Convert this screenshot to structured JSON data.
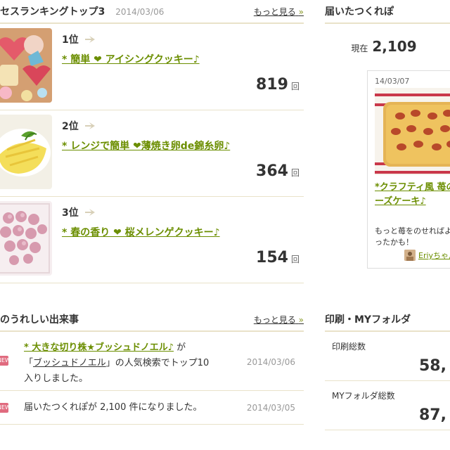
{
  "access_ranking": {
    "title": "セスランキングトップ3",
    "date": "2014/03/06",
    "more_link": "もっと見る",
    "more_arrow": "»",
    "unit": "回",
    "items": [
      {
        "rank": "1位",
        "title": "* 簡単 ❤ アイシングクッキー♪",
        "count": "819"
      },
      {
        "rank": "2位",
        "title": "* レンジで簡単 ❤薄焼き卵de錦糸卵♪",
        "count": "364"
      },
      {
        "rank": "3位",
        "title": "* 春の香り ❤ 桜メレンゲクッキー♪",
        "count": "154"
      }
    ]
  },
  "tsukurepo": {
    "title": "届いたつくれぽ",
    "current_label": "現在",
    "current_value": "2,109",
    "card": {
      "date": "14/03/07",
      "title": "*クラフティ風 苺のチーズケーキ♪",
      "comment": "もっと苺をのせればよかったかも！",
      "user": "Eriyちゃん"
    }
  },
  "events": {
    "title": "のうれしい出来事",
    "more_link": "もっと見る",
    "more_arrow": "»",
    "items": [
      {
        "badge": "NEW",
        "link": "* 大きな切り株★ブッシュドノエル♪",
        "text_after_link": " が",
        "quote_open": "「",
        "keyword": "ブッシュドノエル",
        "text_rest": "」の人気検索でトップ10",
        "text_line3": "入りしました。",
        "date": "2014/03/06"
      },
      {
        "badge": "NEW",
        "text": "届いたつくれぽが 2,100 件になりました。",
        "date": "2014/03/05"
      }
    ]
  },
  "print_folder": {
    "title": "印刷・MYフォルダ",
    "print_label": "印刷総数",
    "print_value": "58,",
    "folder_label": "MYフォルダ総数",
    "folder_value": "87,"
  },
  "colors": {
    "link_green": "#6b8e00",
    "divider": "#e9e2c9",
    "badge_pink": "#e06b7f"
  }
}
